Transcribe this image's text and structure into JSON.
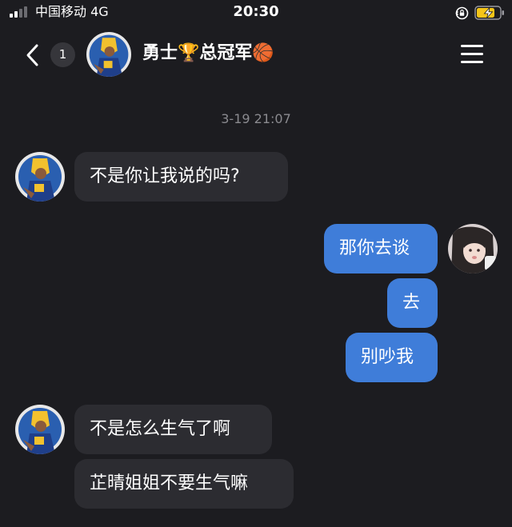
{
  "status_bar": {
    "carrier": "中国移动  4G",
    "time": "20:30",
    "battery_icon": "battery-charging-icon",
    "lock_icon": "rotation-lock-icon"
  },
  "header": {
    "unread_count": "1",
    "title": "勇士🏆总冠军🏀",
    "back_icon": "chevron-left-icon",
    "menu_icon": "hamburger-menu-icon"
  },
  "chat": {
    "timestamp": "3-19 21:07",
    "messages": [
      {
        "side": "in",
        "text": "不是你让我说的吗?"
      },
      {
        "side": "out",
        "text": "那你去谈"
      },
      {
        "side": "out",
        "text": "去"
      },
      {
        "side": "out",
        "text": "别吵我"
      },
      {
        "side": "in",
        "text": "不是怎么生气了啊"
      },
      {
        "side": "in",
        "text": "芷晴姐姐不要生气嘛"
      }
    ]
  },
  "colors": {
    "background": "#1c1c20",
    "incoming_bubble": "#2c2c31",
    "outgoing_bubble": "#3f7dd9",
    "timestamp": "#8a8a8f",
    "battery_fill": "#f5c518"
  }
}
